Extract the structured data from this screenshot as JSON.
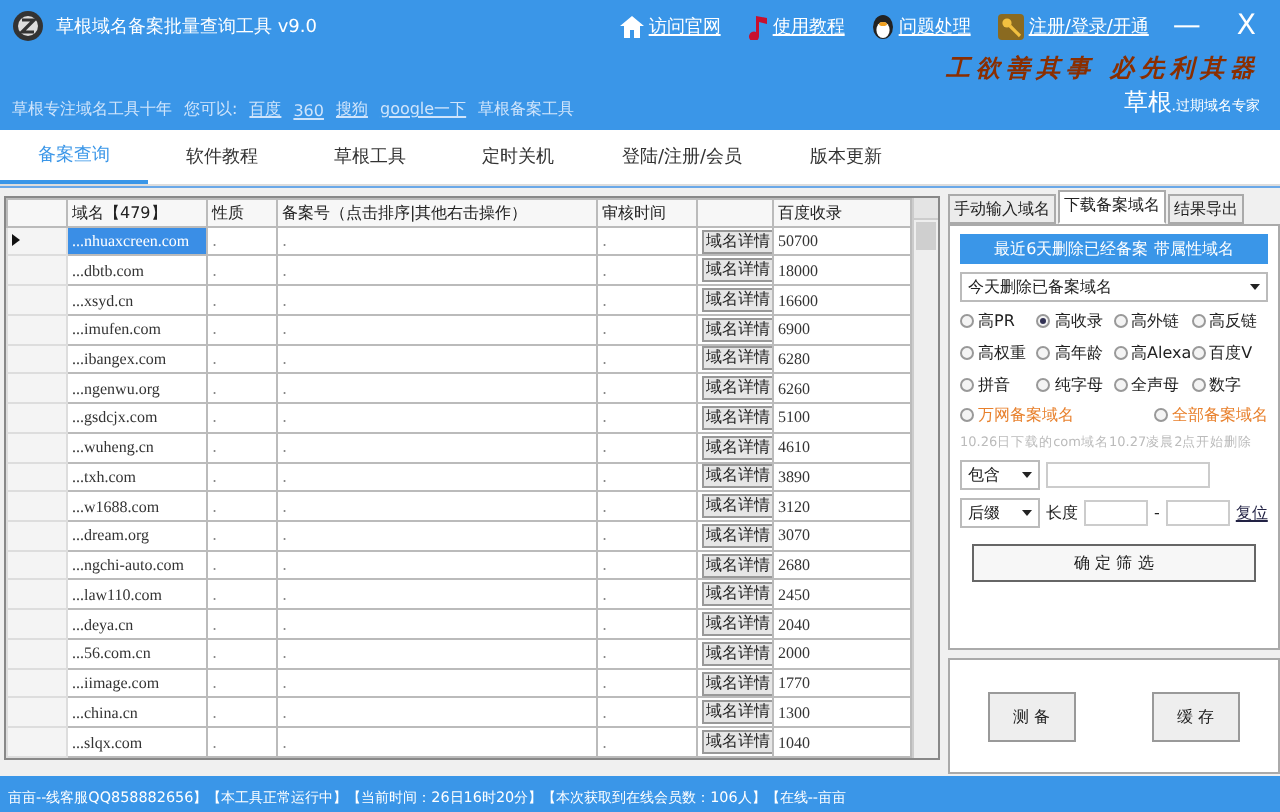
{
  "window": {
    "title": "草根域名备案批量查询工具 v9.0",
    "links": [
      "访问官网",
      "使用教程",
      "问题处理",
      "注册/登录/开通"
    ],
    "minimize": "—",
    "close": "X"
  },
  "banner": {
    "slogan": "工欲善其事 必先利其器",
    "brand": "草根",
    "brand_sub": ".过期域名专家"
  },
  "subline": {
    "intro": "草根专注域名工具十年",
    "prompt": "您可以:",
    "links": [
      "百度",
      "360",
      "搜狗",
      "google一下"
    ],
    "tool": "草根备案工具"
  },
  "tabs": [
    {
      "label": "备案查询",
      "selected": true
    },
    {
      "label": "软件教程",
      "selected": false
    },
    {
      "label": "草根工具",
      "selected": false
    },
    {
      "label": "定时关机",
      "selected": false
    },
    {
      "label": "登陆/注册/会员",
      "selected": false
    },
    {
      "label": "版本更新",
      "selected": false
    }
  ],
  "table": {
    "columns": [
      "域名【479】",
      "性质",
      "备案号（点击排序|其他右击操作）",
      "审核时间",
      "",
      "百度收录"
    ],
    "rows": [
      {
        "domain": "...nhuaxcreen.com",
        "nature": ".",
        "record": ".",
        "audit": ".",
        "button": "域名详情",
        "baidu": "50700",
        "selected": true
      },
      {
        "domain": "...dbtb.com",
        "nature": ".",
        "record": ".",
        "audit": ".",
        "button": "域名详情",
        "baidu": "18000",
        "selected": false
      },
      {
        "domain": "...xsyd.cn",
        "nature": ".",
        "record": ".",
        "audit": ".",
        "button": "域名详情",
        "baidu": "16600",
        "selected": false
      },
      {
        "domain": "...imufen.com",
        "nature": ".",
        "record": ".",
        "audit": ".",
        "button": "域名详情",
        "baidu": "6900",
        "selected": false
      },
      {
        "domain": "...ibangex.com",
        "nature": ".",
        "record": ".",
        "audit": ".",
        "button": "域名详情",
        "baidu": "6280",
        "selected": false
      },
      {
        "domain": "...ngenwu.org",
        "nature": ".",
        "record": ".",
        "audit": ".",
        "button": "域名详情",
        "baidu": "6260",
        "selected": false
      },
      {
        "domain": "...gsdcjx.com",
        "nature": ".",
        "record": ".",
        "audit": ".",
        "button": "域名详情",
        "baidu": "5100",
        "selected": false
      },
      {
        "domain": "...wuheng.cn",
        "nature": ".",
        "record": ".",
        "audit": ".",
        "button": "域名详情",
        "baidu": "4610",
        "selected": false
      },
      {
        "domain": "...txh.com",
        "nature": ".",
        "record": ".",
        "audit": ".",
        "button": "域名详情",
        "baidu": "3890",
        "selected": false
      },
      {
        "domain": "...w1688.com",
        "nature": ".",
        "record": ".",
        "audit": ".",
        "button": "域名详情",
        "baidu": "3120",
        "selected": false
      },
      {
        "domain": "...dream.org",
        "nature": ".",
        "record": ".",
        "audit": ".",
        "button": "域名详情",
        "baidu": "3070",
        "selected": false
      },
      {
        "domain": "...ngchi-auto.com",
        "nature": ".",
        "record": ".",
        "audit": ".",
        "button": "域名详情",
        "baidu": "2680",
        "selected": false
      },
      {
        "domain": "...law110.com",
        "nature": ".",
        "record": ".",
        "audit": ".",
        "button": "域名详情",
        "baidu": "2450",
        "selected": false
      },
      {
        "domain": "...deya.cn",
        "nature": ".",
        "record": ".",
        "audit": ".",
        "button": "域名详情",
        "baidu": "2040",
        "selected": false
      },
      {
        "domain": "...56.com.cn",
        "nature": ".",
        "record": ".",
        "audit": ".",
        "button": "域名详情",
        "baidu": "2000",
        "selected": false
      },
      {
        "domain": "...iimage.com",
        "nature": ".",
        "record": ".",
        "audit": ".",
        "button": "域名详情",
        "baidu": "1770",
        "selected": false
      },
      {
        "domain": "...china.cn",
        "nature": ".",
        "record": ".",
        "audit": ".",
        "button": "域名详情",
        "baidu": "1300",
        "selected": false
      },
      {
        "domain": "...slqx.com",
        "nature": ".",
        "record": ".",
        "audit": ".",
        "button": "域名详情",
        "baidu": "1040",
        "selected": false
      }
    ]
  },
  "panel": {
    "tabs": [
      {
        "label": "手动输入域名",
        "selected": false
      },
      {
        "label": "下载备案域名",
        "selected": true
      },
      {
        "label": "结果导出",
        "selected": false
      }
    ],
    "heading": "最近6天删除已经备案 带属性域名",
    "dropdown": "今天删除已备案域名",
    "radios": [
      {
        "label": "高PR",
        "selected": false
      },
      {
        "label": "高收录",
        "selected": true
      },
      {
        "label": "高外链",
        "selected": false
      },
      {
        "label": "高反链",
        "selected": false
      },
      {
        "label": "高权重",
        "selected": false
      },
      {
        "label": "高年龄",
        "selected": false
      },
      {
        "label": "高Alexa",
        "selected": false
      },
      {
        "label": "百度V",
        "selected": false
      },
      {
        "label": "拼音",
        "selected": false
      },
      {
        "label": "纯字母",
        "selected": false
      },
      {
        "label": "全声母",
        "selected": false
      },
      {
        "label": "数字",
        "selected": false
      }
    ],
    "special_radios": [
      {
        "label": "万网备案域名",
        "selected": false
      },
      {
        "label": "全部备案域名",
        "selected": false
      }
    ],
    "note": "10.26日下载的com域名10.27凌晨2点开始删除",
    "contains": "包含",
    "suffix": "后缀",
    "length_label": "长度",
    "dash": "-",
    "reset": "复位",
    "filter_button": "确 定 筛 选",
    "bottom_buttons": [
      "测 备",
      "缓 存"
    ]
  },
  "status_bar": "亩亩--线客服QQ858882656】【本工具正常运行中】【当前时间：26日16时20分】【本次获取到在线会员数：106人】【在线--亩亩"
}
